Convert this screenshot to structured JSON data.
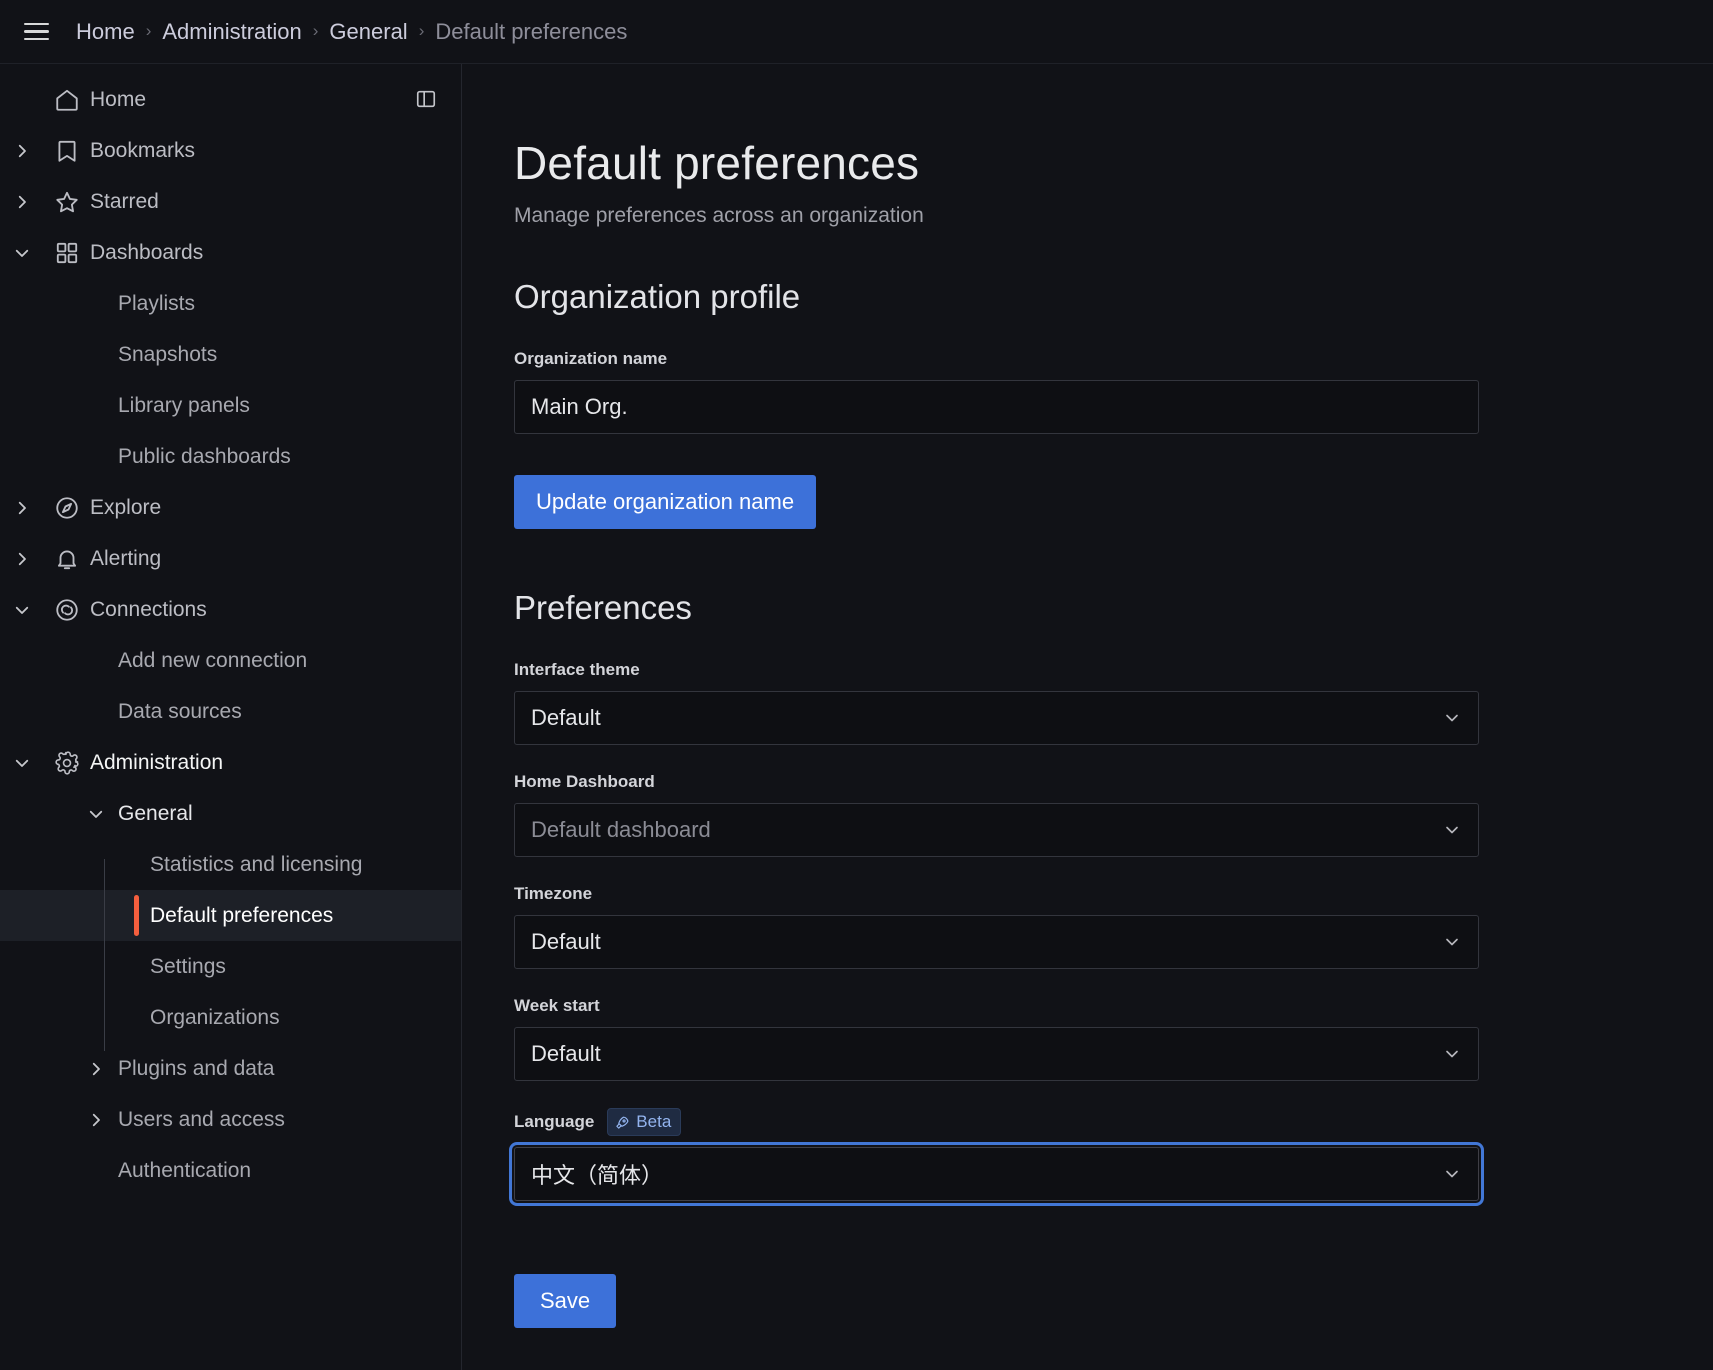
{
  "breadcrumb": {
    "menu_icon": "hamburger-menu-icon",
    "items": [
      "Home",
      "Administration",
      "General",
      "Default preferences"
    ],
    "separator": "›"
  },
  "sidebar": {
    "dock_icon": "dock-menu-icon",
    "items": [
      {
        "label": "Home",
        "icon": "home-icon",
        "level": 0,
        "chevron": "none"
      },
      {
        "label": "Bookmarks",
        "icon": "bookmark-icon",
        "level": 0,
        "chevron": "right"
      },
      {
        "label": "Starred",
        "icon": "star-icon",
        "level": 0,
        "chevron": "right"
      },
      {
        "label": "Dashboards",
        "icon": "dashboards-grid-icon",
        "level": 0,
        "chevron": "down"
      },
      {
        "label": "Playlists",
        "icon": "none",
        "level": 1,
        "chevron": "none"
      },
      {
        "label": "Snapshots",
        "icon": "none",
        "level": 1,
        "chevron": "none"
      },
      {
        "label": "Library panels",
        "icon": "none",
        "level": 1,
        "chevron": "none"
      },
      {
        "label": "Public dashboards",
        "icon": "none",
        "level": 1,
        "chevron": "none"
      },
      {
        "label": "Explore",
        "icon": "compass-icon",
        "level": 0,
        "chevron": "right"
      },
      {
        "label": "Alerting",
        "icon": "bell-icon",
        "level": 0,
        "chevron": "right"
      },
      {
        "label": "Connections",
        "icon": "connections-icon",
        "level": 0,
        "chevron": "down"
      },
      {
        "label": "Add new connection",
        "icon": "none",
        "level": 1,
        "chevron": "none"
      },
      {
        "label": "Data sources",
        "icon": "none",
        "level": 1,
        "chevron": "none"
      },
      {
        "label": "Administration",
        "icon": "gear-icon",
        "level": 0,
        "chevron": "down"
      },
      {
        "label": "General",
        "icon": "none",
        "level": 1,
        "chevron": "down"
      },
      {
        "label": "Statistics and licensing",
        "icon": "none",
        "level": 2,
        "chevron": "none"
      },
      {
        "label": "Default preferences",
        "icon": "none",
        "level": 2,
        "chevron": "none",
        "selected": true
      },
      {
        "label": "Settings",
        "icon": "none",
        "level": 2,
        "chevron": "none"
      },
      {
        "label": "Organizations",
        "icon": "none",
        "level": 2,
        "chevron": "none"
      },
      {
        "label": "Plugins and data",
        "icon": "none",
        "level": 1,
        "chevron": "right"
      },
      {
        "label": "Users and access",
        "icon": "none",
        "level": 1,
        "chevron": "right"
      },
      {
        "label": "Authentication",
        "icon": "none",
        "level": 1,
        "chevron": "none"
      }
    ],
    "active_accent_color": "#f55f3e"
  },
  "main": {
    "title": "Default preferences",
    "subtitle": "Manage preferences across an organization",
    "org_section": {
      "heading": "Organization profile",
      "org_name_label": "Organization name",
      "org_name_value": "Main Org.",
      "org_name_placeholder": "Organization name",
      "update_button": "Update organization name"
    },
    "prefs_section": {
      "heading": "Preferences",
      "interface_theme_label": "Interface theme",
      "interface_theme_value": "Default",
      "home_dashboard_label": "Home Dashboard",
      "home_dashboard_placeholder": "Default dashboard",
      "timezone_label": "Timezone",
      "timezone_value": "Default",
      "week_start_label": "Week start",
      "week_start_value": "Default",
      "language_label": "Language",
      "language_badge": "Beta",
      "language_badge_icon": "rocket-icon",
      "language_value": "中文（简体）",
      "save_button": "Save"
    },
    "accent_button_color": "#3d71d9",
    "focus_ring_color": "#4277d6"
  }
}
